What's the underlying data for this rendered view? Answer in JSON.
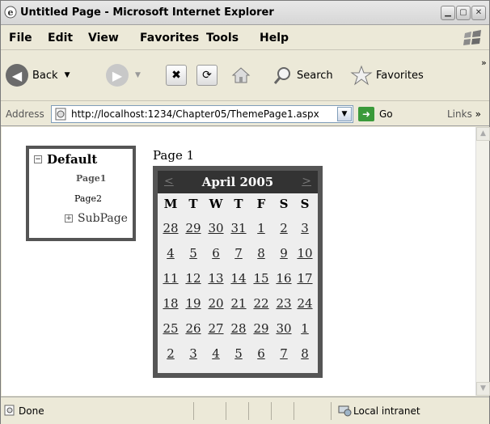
{
  "window": {
    "title": "Untitled Page - Microsoft Internet Explorer",
    "buttons": [
      "minimize",
      "maximize",
      "close"
    ]
  },
  "menubar": {
    "items": [
      {
        "label": "File"
      },
      {
        "label": "Edit"
      },
      {
        "label": "View"
      },
      {
        "label": "Favorites"
      },
      {
        "label": "Tools"
      },
      {
        "label": "Help"
      }
    ]
  },
  "toolbar": {
    "back_label": "Back",
    "search_label": "Search",
    "favorites_label": "Favorites"
  },
  "addressbar": {
    "label": "Address",
    "url": "http://localhost:1234/Chapter05/ThemePage1.aspx",
    "go_label": "Go",
    "links_label": "Links"
  },
  "tree": {
    "root": "Default",
    "items": [
      {
        "label": "Page1"
      },
      {
        "label": "Page2"
      },
      {
        "label": "SubPage"
      }
    ]
  },
  "page": {
    "title": "Page 1"
  },
  "calendar": {
    "title": "April 2005",
    "prev": "<",
    "next": ">",
    "day_headers": [
      "M",
      "T",
      "W",
      "T",
      "F",
      "S",
      "S"
    ],
    "weeks": [
      [
        "28",
        "29",
        "30",
        "31",
        "1",
        "2",
        "3"
      ],
      [
        "4",
        "5",
        "6",
        "7",
        "8",
        "9",
        "10"
      ],
      [
        "11",
        "12",
        "13",
        "14",
        "15",
        "16",
        "17"
      ],
      [
        "18",
        "19",
        "20",
        "21",
        "22",
        "23",
        "24"
      ],
      [
        "25",
        "26",
        "27",
        "28",
        "29",
        "30",
        "1"
      ],
      [
        "2",
        "3",
        "4",
        "5",
        "6",
        "7",
        "8"
      ]
    ]
  },
  "statusbar": {
    "status": "Done",
    "zone": "Local intranet"
  }
}
